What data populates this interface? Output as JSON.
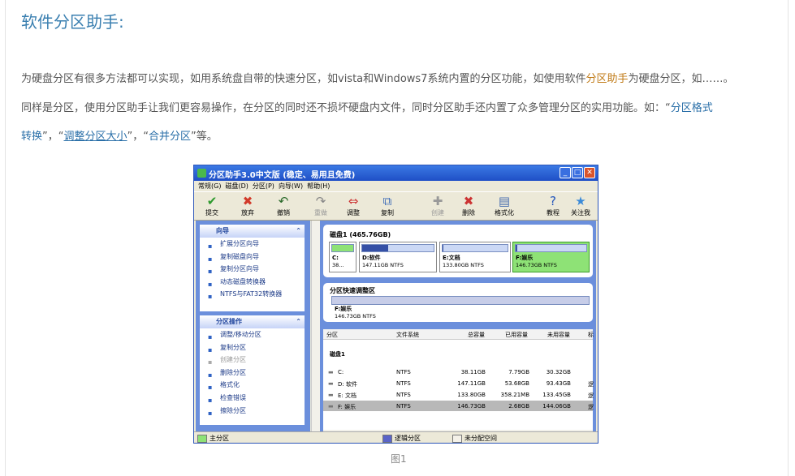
{
  "article": {
    "title": "软件分区助手:",
    "p1": [
      "为硬盘分区有很多方法都可以实现，如用系统盘自带的快速分区，如vista和Windows7系统内置的分区功能，如使用软件",
      "分区助手",
      "为硬盘分区，如……。"
    ],
    "p2": "同样是分区，使用分区助手让我们更容易操作，在分区的同时还不损坏硬盘内文件，同时分区助手还内置了众多管理分区的实用功能。如：“",
    "p2_link": "分区格式",
    "p3": [
      "转换",
      "”，“",
      "调整分区大小",
      "”，“",
      "合并分区",
      "”等。"
    ],
    "caption": "图1"
  },
  "app": {
    "title": "分区助手3.0中文版 (稳定、易用且免费)",
    "menu": [
      "常规(G)",
      "磁盘(D)",
      "分区(P)",
      "向导(W)",
      "帮助(H)"
    ],
    "toolbar": [
      {
        "label": "提交",
        "glyph": "✔",
        "color": "#2e9a2e",
        "enabled": true
      },
      {
        "label": "放弃",
        "glyph": "✖",
        "color": "#d23a2a",
        "enabled": true
      },
      {
        "label": "撤销",
        "glyph": "↶",
        "color": "#2b6a2b",
        "enabled": true
      },
      {
        "label": "重做",
        "glyph": "↷",
        "color": "#888",
        "enabled": false
      },
      {
        "label": "调整",
        "glyph": "⇔",
        "color": "#c33",
        "enabled": true
      },
      {
        "label": "复制",
        "glyph": "⧉",
        "color": "#3b6ab8",
        "enabled": true
      },
      {
        "label": "创建",
        "glyph": "✚",
        "color": "#999",
        "enabled": false
      },
      {
        "label": "删除",
        "glyph": "✖",
        "color": "#c33",
        "enabled": true
      },
      {
        "label": "格式化",
        "glyph": "▤",
        "color": "#4a6fb0",
        "enabled": true
      },
      {
        "label": "教程",
        "glyph": "?",
        "color": "#2255bb",
        "enabled": true
      },
      {
        "label": "关注我",
        "glyph": "★",
        "color": "#3a8ad8",
        "enabled": true
      }
    ],
    "wizard": {
      "title": "向导",
      "items": [
        {
          "label": "扩展分区向导",
          "enabled": true
        },
        {
          "label": "复制磁盘向导",
          "enabled": true
        },
        {
          "label": "复制分区向导",
          "enabled": true
        },
        {
          "label": "动态磁盘转换器",
          "enabled": true
        },
        {
          "label": "NTFS与FAT32转换器",
          "enabled": true
        }
      ]
    },
    "ops": {
      "title": "分区操作",
      "items": [
        {
          "label": "调整/移动分区",
          "enabled": true
        },
        {
          "label": "复制分区",
          "enabled": true
        },
        {
          "label": "创建分区",
          "enabled": false
        },
        {
          "label": "删除分区",
          "enabled": true
        },
        {
          "label": "格式化",
          "enabled": true
        },
        {
          "label": "检查错误",
          "enabled": true
        },
        {
          "label": "擦除分区",
          "enabled": true
        }
      ]
    },
    "disk": {
      "label": "磁盘1 (465.76GB)",
      "partitions": [
        {
          "name": "C:",
          "size": "38...",
          "used_fraction": 1.0
        },
        {
          "name": "D:软件",
          "size": "147.11GB NTFS",
          "used_fraction": 0.36
        },
        {
          "name": "E:文档",
          "size": "133.80GB NTFS",
          "used_fraction": 0.01
        },
        {
          "name": "F:娱乐",
          "size": "146.73GB NTFS",
          "used_fraction": 0.02
        }
      ]
    },
    "quick": {
      "title": "分区快速调整区",
      "name": "F:娱乐",
      "size": "146.73GB NTFS"
    },
    "table": {
      "columns": [
        "分区",
        "文件系统",
        "总容量",
        "已用容量",
        "未用容量",
        "标"
      ],
      "group": "磁盘1",
      "rows": [
        {
          "part": "C:",
          "fs": "NTFS",
          "total": "38.11GB",
          "used": "7.79GB",
          "free": "30.32GB",
          "flag": ""
        },
        {
          "part": "D: 软件",
          "fs": "NTFS",
          "total": "147.11GB",
          "used": "53.68GB",
          "free": "93.43GB",
          "flag": "逻"
        },
        {
          "part": "E: 文档",
          "fs": "NTFS",
          "total": "133.80GB",
          "used": "358.21MB",
          "free": "133.45GB",
          "flag": "逻"
        },
        {
          "part": "F: 娱乐",
          "fs": "NTFS",
          "total": "146.73GB",
          "used": "2.68GB",
          "free": "144.06GB",
          "flag": "逻"
        }
      ]
    },
    "legend": [
      {
        "label": "主分区",
        "color": "#8ee276"
      },
      {
        "label": "逻辑分区",
        "color": "#5a64c8"
      },
      {
        "label": "未分配空间",
        "color": "#f4f1e8"
      }
    ]
  }
}
